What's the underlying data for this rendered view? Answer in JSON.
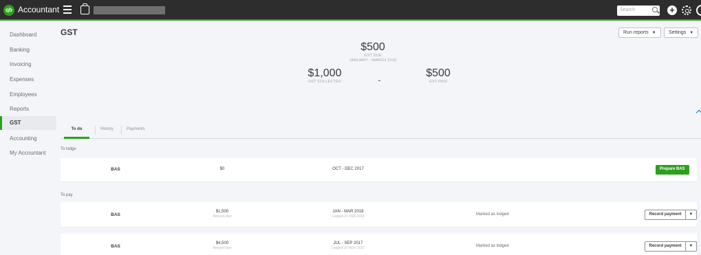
{
  "topbar": {
    "logo_text": "qb",
    "brand": "Accountant",
    "search_placeholder": "Search",
    "plus_glyph": "+",
    "icons": [
      "hamburger-icon",
      "briefcase-icon",
      "search-icon",
      "plus-icon",
      "gear-icon",
      "help-icon"
    ]
  },
  "sidebar": {
    "items": [
      {
        "label": "Dashboard"
      },
      {
        "label": "Banking"
      },
      {
        "label": "Invoicing"
      },
      {
        "label": "Expenses"
      },
      {
        "label": "Employees"
      },
      {
        "label": "Reports"
      },
      {
        "label": "GST"
      },
      {
        "label": "Accounting"
      },
      {
        "label": "My Accountant"
      }
    ],
    "active": "GST"
  },
  "header": {
    "title": "GST",
    "run_reports": "Run reports",
    "settings": "Settings",
    "caret": "▼"
  },
  "summary": {
    "due_amount": "$500",
    "due_label": "GST DUE",
    "period": "JANUARY - MARCH 2018",
    "collected_amount": "$1,000",
    "collected_label": "GST COLLECTED",
    "separator": "-",
    "paid_amount": "$500",
    "paid_label": "GST PAID"
  },
  "tabs": [
    {
      "label": "To do"
    },
    {
      "label": "History"
    },
    {
      "label": "Payments"
    }
  ],
  "to_lodge": {
    "label": "To lodge",
    "row": {
      "type": "BAS",
      "amount": "$0",
      "period": "OCT - DEC 2017",
      "action": "Prepare BAS"
    }
  },
  "to_pay": {
    "label": "To pay",
    "rows": [
      {
        "type": "BAS",
        "amount": "$1,500",
        "amount_caption": "Amount due",
        "period": "JAN - MAR 2018",
        "period_caption": "Lodged 21 FEB 2018",
        "status": "Marked as lodged",
        "action": "Record payment",
        "arrow": "▼"
      },
      {
        "type": "BAS",
        "amount": "$4,500",
        "amount_caption": "Amount due",
        "period": "JUL - SEP 2017",
        "period_caption": "Lodged 07 NOV 2017",
        "status": "Marked as lodged",
        "action": "Record payment",
        "arrow": "▼"
      }
    ]
  },
  "colors": {
    "accent": "#2ca01c",
    "topbar": "#2d2d2d",
    "background": "#f4f5f8"
  }
}
